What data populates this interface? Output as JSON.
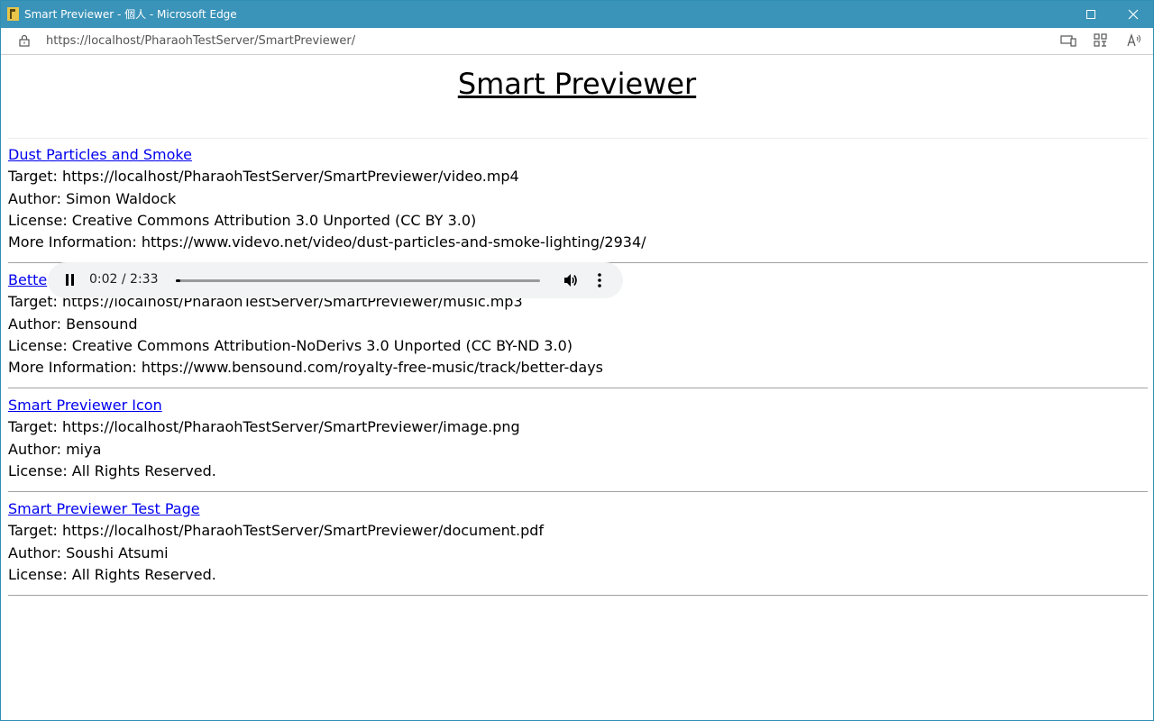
{
  "window": {
    "title": "Smart Previewer - 個人 - Microsoft Edge",
    "accent_color": "#3a93b8"
  },
  "browser": {
    "url": "https://localhost/PharaohTestServer/SmartPreviewer/"
  },
  "page": {
    "title": "Smart Previewer",
    "entries": [
      {
        "name": "Dust Particles and Smoke",
        "target": "Target: https://localhost/PharaohTestServer/SmartPreviewer/video.mp4",
        "author": "Author: Simon Waldock",
        "license": "License: Creative Commons Attribution 3.0 Unported (CC BY 3.0)",
        "more": "More Information: https://www.videvo.net/video/dust-particles-and-smoke-lighting/2934/"
      },
      {
        "name": "Bette",
        "target": "Target: https://localhost/PharaohTestServer/SmartPreviewer/music.mp3",
        "author": "Author: Bensound",
        "license": "License: Creative Commons Attribution-NoDerivs 3.0 Unported (CC BY-ND 3.0)",
        "more": "More Information: https://www.bensound.com/royalty-free-music/track/better-days"
      },
      {
        "name": "Smart Previewer Icon",
        "target": "Target: https://localhost/PharaohTestServer/SmartPreviewer/image.png",
        "author": "Author: miya",
        "license": "License: All Rights Reserved."
      },
      {
        "name": "Smart Previewer Test Page",
        "target": "Target: https://localhost/PharaohTestServer/SmartPreviewer/document.pdf",
        "author": "Author: Soushi Atsumi",
        "license": "License: All Rights Reserved."
      }
    ]
  },
  "audio_player": {
    "time": "0:02 / 2:33",
    "progress_fraction": 0.013,
    "state": "playing",
    "icons": [
      "pause-icon",
      "volume-icon",
      "more-options-icon"
    ]
  }
}
